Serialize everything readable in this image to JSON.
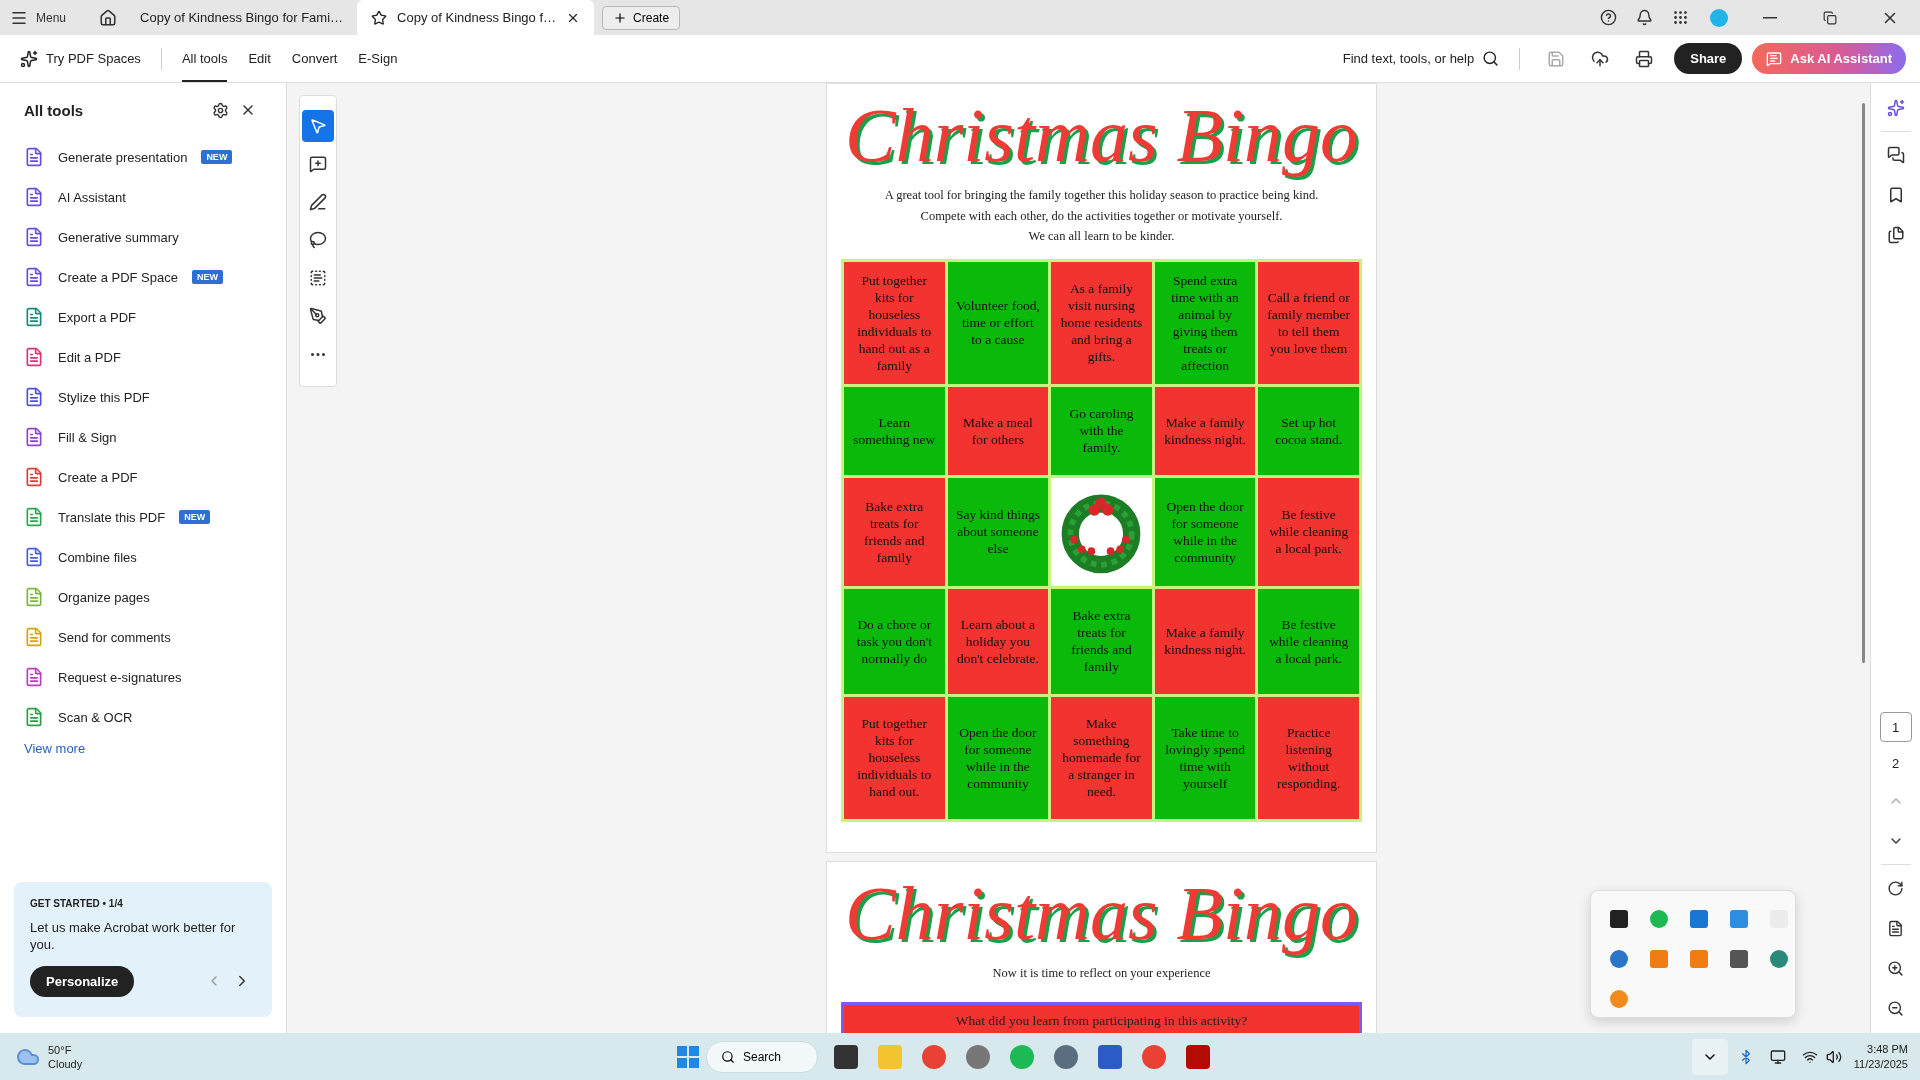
{
  "title_bar": {
    "menu": "Menu",
    "tabs": [
      {
        "label": "Copy of Kindness Bingo for Fami…",
        "selected": false
      },
      {
        "label": "Copy of Kindness Bingo f…",
        "selected": true
      }
    ],
    "create": "Create"
  },
  "toolbar": {
    "spaces": "Try PDF Spaces",
    "tabs": [
      {
        "label": "All tools",
        "selected": true
      },
      {
        "label": "Edit",
        "selected": false
      },
      {
        "label": "Convert",
        "selected": false
      },
      {
        "label": "E-Sign",
        "selected": false
      }
    ],
    "search": "Find text, tools, or help",
    "share": "Share",
    "ask_ai": "Ask AI Assistant"
  },
  "sidebar": {
    "title": "All tools",
    "items": [
      {
        "label": "Generate presentation",
        "badge": "NEW",
        "color": "#6b4fd8"
      },
      {
        "label": "AI Assistant",
        "color": "#6b4fd8"
      },
      {
        "label": "Generative summary",
        "color": "#6b4fd8"
      },
      {
        "label": "Create a PDF Space",
        "badge": "NEW",
        "color": "#6b4fd8"
      },
      {
        "label": "Export a PDF",
        "color": "#1a8a7a"
      },
      {
        "label": "Edit a PDF",
        "color": "#d6357a"
      },
      {
        "label": "Stylize this PDF",
        "color": "#5151d3"
      },
      {
        "label": "Fill & Sign",
        "color": "#8a47c9"
      },
      {
        "label": "Create a PDF",
        "color": "#dc3c3c"
      },
      {
        "label": "Translate this PDF",
        "badge": "NEW",
        "color": "#2ea44f"
      },
      {
        "label": "Combine files",
        "color": "#4a5fd6"
      },
      {
        "label": "Organize pages",
        "color": "#7cb342"
      },
      {
        "label": "Send for comments",
        "color": "#d4a30e"
      },
      {
        "label": "Request e-signatures",
        "color": "#b83fb8"
      },
      {
        "label": "Scan & OCR",
        "color": "#2e9d46"
      }
    ],
    "view_more": "View more",
    "card": {
      "heading": "GET STARTED • 1/4",
      "text": "Let us make Acrobat work better for you.",
      "button": "Personalize"
    }
  },
  "document": {
    "pages": [
      {
        "title": "Christmas Bingo",
        "intro": [
          "A great tool for bringing the family together this holiday season to practice being kind.",
          "Compete with each other, do the activities together or motivate yourself.",
          "We can all learn to be kinder."
        ],
        "grid": [
          [
            {
              "kind": "text",
              "text": "Put together kits for houseless individuals to hand out as a family",
              "color": "#f2332f"
            },
            {
              "kind": "text",
              "text": "Volunteer food, time or effort to a cause",
              "color": "#0ab90a"
            },
            {
              "kind": "text",
              "text": "As a family visit nursing home residents and bring a gifts.",
              "color": "#f2332f"
            },
            {
              "kind": "text",
              "text": "Spend extra time with an animal by giving them treats or affection",
              "color": "#0ab90a"
            },
            {
              "kind": "text",
              "text": "Call a friend or family member to tell them you love them",
              "color": "#f2332f"
            }
          ],
          [
            {
              "kind": "text",
              "text": "Learn something new",
              "color": "#0ab90a"
            },
            {
              "kind": "text",
              "text": "Make a meal for others",
              "color": "#f2332f"
            },
            {
              "kind": "text",
              "text": "Go caroling with the family.",
              "color": "#0ab90a"
            },
            {
              "kind": "text",
              "text": "Make a family kindness night.",
              "color": "#f2332f"
            },
            {
              "kind": "text",
              "text": "Set up hot cocoa stand.",
              "color": "#0ab90a"
            }
          ],
          [
            {
              "kind": "text",
              "text": "Bake extra treats for friends and family",
              "color": "#f2332f"
            },
            {
              "kind": "text",
              "text": "Say kind things about someone else",
              "color": "#0ab90a"
            },
            {
              "kind": "wreath"
            },
            {
              "kind": "text",
              "text": "Open the door for someone while in the community",
              "color": "#0ab90a"
            },
            {
              "kind": "text",
              "text": "Be festive while cleaning a local park.",
              "color": "#f2332f"
            }
          ],
          [
            {
              "kind": "text",
              "text": "Do a chore or task you don't normally do",
              "color": "#0ab90a"
            },
            {
              "kind": "text",
              "text": "Learn about a holiday you don't celebrate.",
              "color": "#f2332f"
            },
            {
              "kind": "text",
              "text": "Bake extra treats for friends and family",
              "color": "#0ab90a"
            },
            {
              "kind": "text",
              "text": "Make a family kindness night.",
              "color": "#f2332f"
            },
            {
              "kind": "text",
              "text": "Be festive while cleaning a local park.",
              "color": "#0ab90a"
            }
          ],
          [
            {
              "kind": "text",
              "text": "Put together kits for houseless individuals to hand out.",
              "color": "#f2332f"
            },
            {
              "kind": "text",
              "text": "Open the door for someone while in the community",
              "color": "#0ab90a"
            },
            {
              "kind": "text",
              "text": "Make something homemade for a stranger in need.",
              "color": "#f2332f"
            },
            {
              "kind": "text",
              "text": "Take time to lovingly spend time with yourself",
              "color": "#0ab90a"
            },
            {
              "kind": "text",
              "text": "Practice listening without responding.",
              "color": "#f2332f"
            }
          ]
        ]
      },
      {
        "title": "Christmas Bingo",
        "intro": [
          "Now it is time to reflect on your experience"
        ],
        "question": "What did you learn from participating in this activity?"
      }
    ]
  },
  "page_nav": [
    {
      "label": "1",
      "selected": true
    },
    {
      "label": "2",
      "selected": false
    }
  ],
  "taskbar": {
    "weather": {
      "temp": "50°F",
      "condition": "Cloudy"
    },
    "search": "Search",
    "time": "3:48 PM",
    "date": "11/23/2025"
  }
}
